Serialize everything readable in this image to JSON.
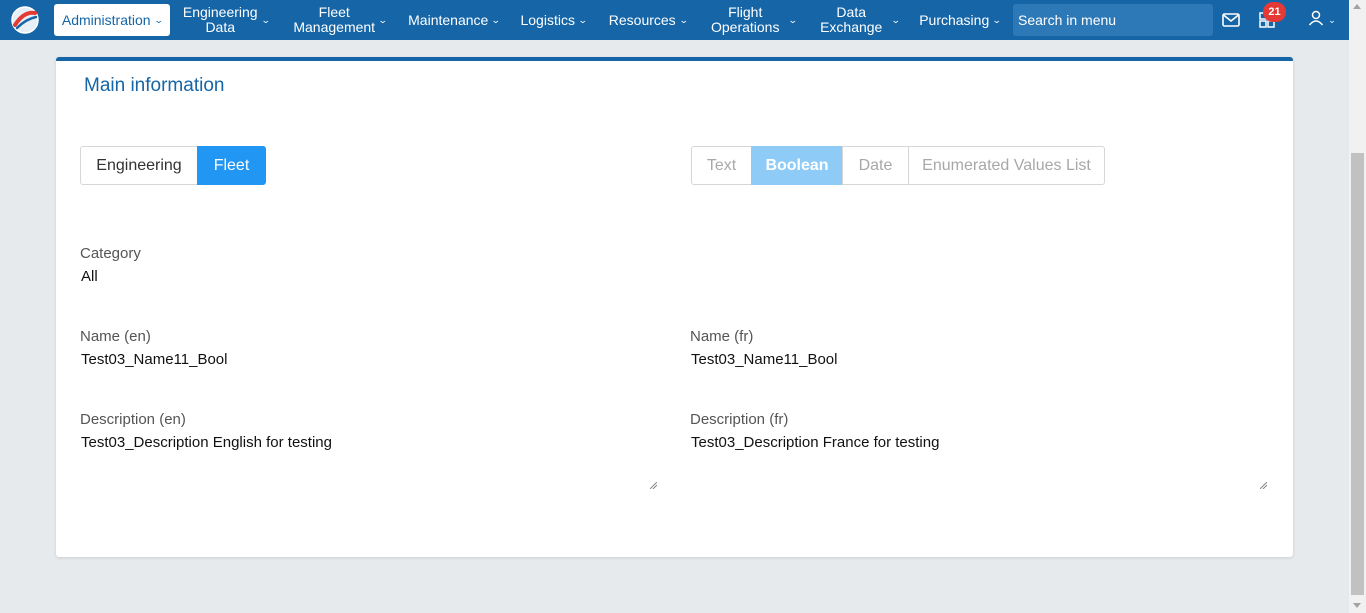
{
  "nav": {
    "items": [
      {
        "label": "Administration",
        "active": true
      },
      {
        "label": "Engineering\nData"
      },
      {
        "label": "Fleet\nManagement"
      },
      {
        "label": "Maintenance"
      },
      {
        "label": "Logistics"
      },
      {
        "label": "Resources"
      },
      {
        "label": "Flight\nOperations"
      },
      {
        "label": "Data\nExchange"
      },
      {
        "label": "Purchasing"
      }
    ],
    "search_placeholder": "Search in menu",
    "badge_count": "21",
    "icons": [
      "app-logo",
      "mail-icon",
      "dashboard-icon",
      "user-icon"
    ]
  },
  "card": {
    "title": "Main information",
    "domain_toggle": {
      "options": [
        "Engineering",
        "Fleet"
      ],
      "selected": "Fleet"
    },
    "type_toggle": {
      "options": [
        "Text",
        "Boolean",
        "Date",
        "Enumerated Values List"
      ],
      "selected": "Boolean"
    },
    "category": {
      "label": "Category",
      "value": "All"
    },
    "name_en": {
      "label": "Name (en)",
      "value": "Test03_Name11_Bool"
    },
    "name_fr": {
      "label": "Name (fr)",
      "value": "Test03_Name11_Bool"
    },
    "desc_en": {
      "label": "Description (en)",
      "value": "Test03_Description English for testing"
    },
    "desc_fr": {
      "label": "Description (fr)",
      "value": "Test03_Description France for testing"
    }
  },
  "colors": {
    "nav": "#1565a7",
    "accent": "#2196f3",
    "accent_light": "#8ecbf7",
    "badge": "#e53935"
  }
}
